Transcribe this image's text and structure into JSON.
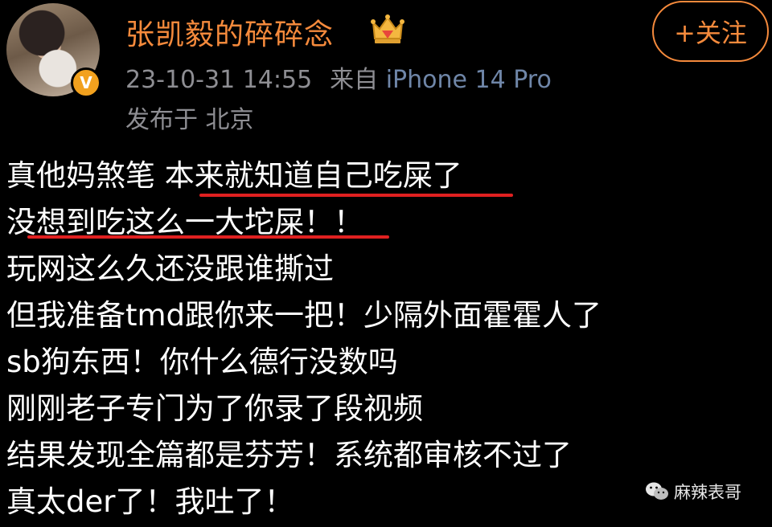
{
  "post_header": {
    "username": "张凯毅的碎碎念",
    "timestamp": "23-10-31 14:55",
    "source_prefix": "来自",
    "device": "iPhone 14 Pro",
    "location": "发布于 北京",
    "follow_label": "+关注",
    "avatar_badge_glyph": "V"
  },
  "post": {
    "lines": [
      "真他妈煞笔 本来就知道自己吃屎了",
      "没想到吃这么一大坨屎！！",
      "玩网这么久还没跟谁撕过",
      "但我准备tmd跟你来一把！少隔外面霍霍人了",
      "sb狗东西！你什么德行没数吗",
      "刚刚老子专门为了你录了段视频",
      "结果发现全篇都是芬芳！系统都审核不过了",
      "真太der了！我吐了！"
    ]
  },
  "watermark": {
    "text": "麻辣表哥",
    "icon": "wechat-icon"
  },
  "colors": {
    "background": "#000000",
    "username": "#f58a3c",
    "meta": "#8e8e93",
    "device": "#6f86a8",
    "underline": "#e02020",
    "badge": "#f2a11e"
  }
}
